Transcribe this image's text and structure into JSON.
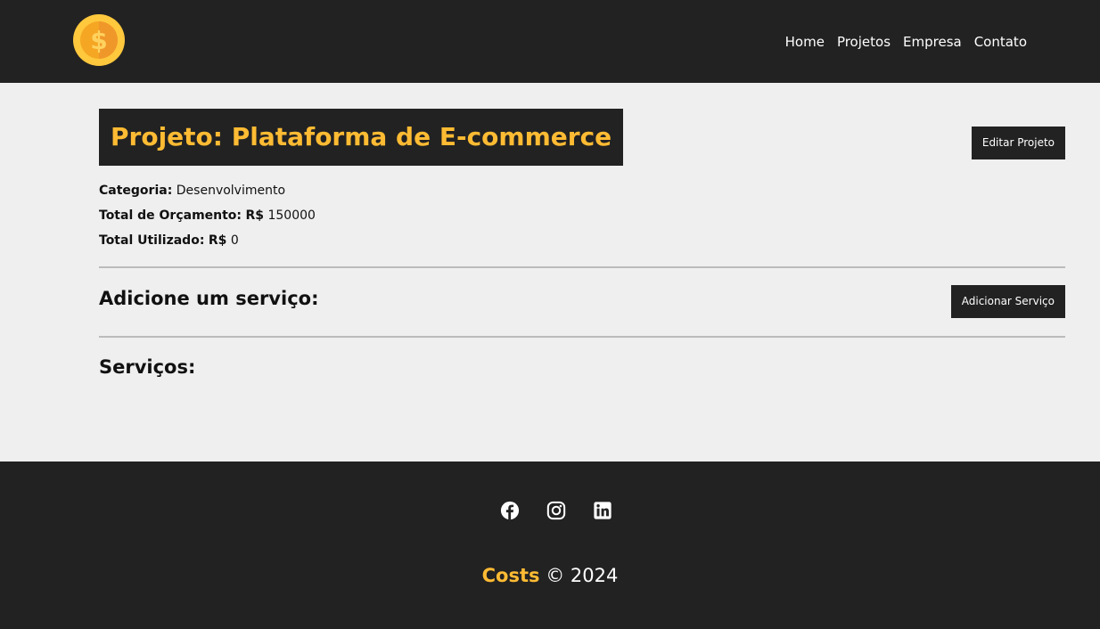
{
  "navbar": {
    "logo_icon": "coin-dollar-icon",
    "links": [
      {
        "label": "Home"
      },
      {
        "label": "Projetos"
      },
      {
        "label": "Empresa"
      },
      {
        "label": "Contato"
      }
    ]
  },
  "project": {
    "title": "Projeto: Plataforma de E-commerce",
    "edit_button": "Editar Projeto",
    "category_label": "Categoria:",
    "category_value": "Desenvolvimento",
    "budget_label": "Total de Orçamento:",
    "budget_currency": "R$",
    "budget_value": "150000",
    "used_label": "Total Utilizado:",
    "used_currency": "R$",
    "used_value": "0"
  },
  "services": {
    "add_heading": "Adicione um serviço:",
    "add_button": "Adicionar Serviço",
    "list_heading": "Serviços:"
  },
  "footer": {
    "social_icons": [
      "facebook-icon",
      "instagram-icon",
      "linkedin-icon"
    ],
    "brand": "Costs",
    "copyright": "© 2024"
  },
  "colors": {
    "dark": "#222222",
    "accent": "#ffbb33",
    "background": "#efefef"
  }
}
